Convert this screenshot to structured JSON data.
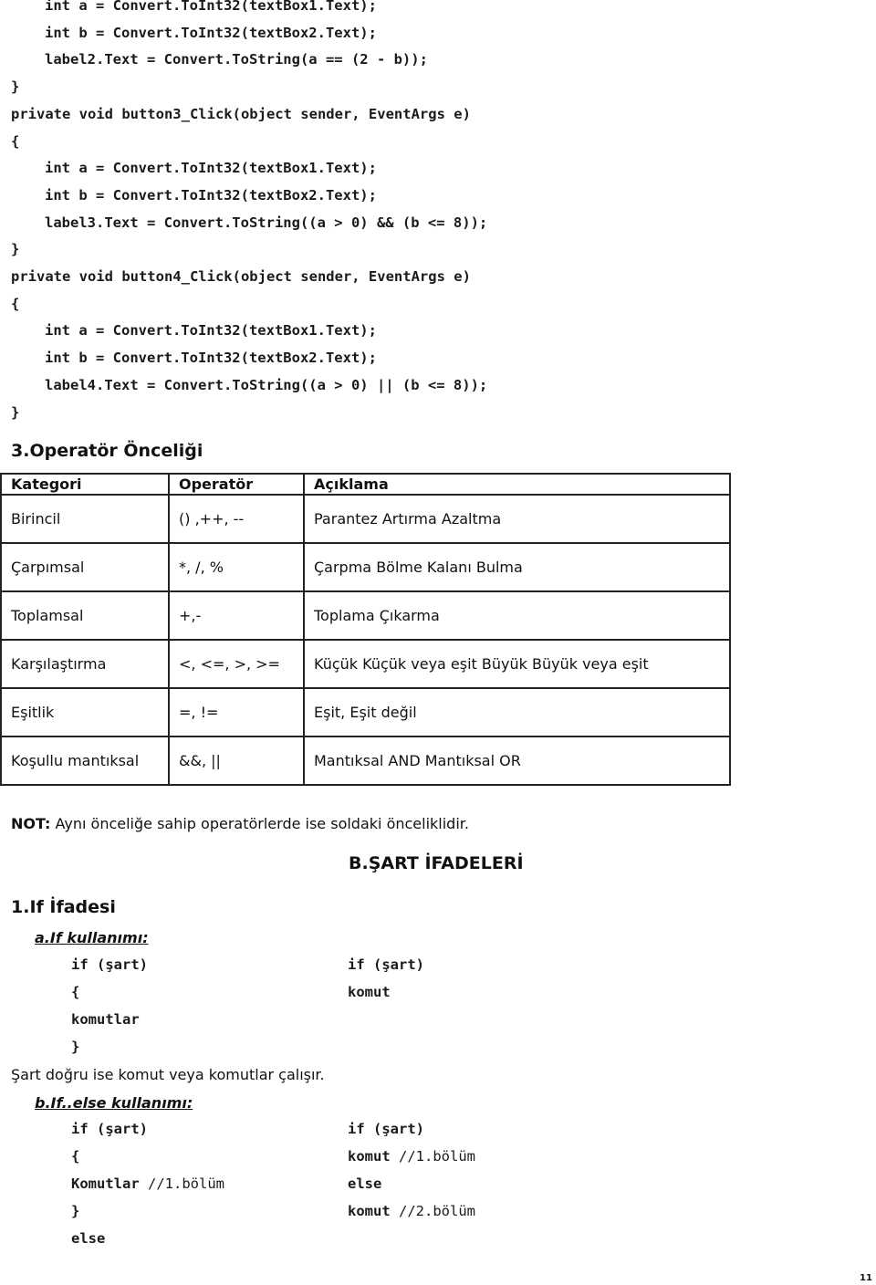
{
  "code_top": [
    {
      "indent": 1,
      "text": "int a = Convert.ToInt32(textBox1.Text);"
    },
    {
      "indent": 1,
      "text": "int b = Convert.ToInt32(textBox2.Text);"
    },
    {
      "indent": 1,
      "text": "label2.Text = Convert.ToString(a == (2 - b));"
    },
    {
      "indent": 0,
      "text": "}"
    },
    {
      "indent": 0,
      "text": "private void button3_Click(object sender, EventArgs e)"
    },
    {
      "indent": 0,
      "text": "{"
    },
    {
      "indent": 1,
      "text": "int a = Convert.ToInt32(textBox1.Text);"
    },
    {
      "indent": 1,
      "text": "int b = Convert.ToInt32(textBox2.Text);"
    },
    {
      "indent": 1,
      "text": "label3.Text = Convert.ToString((a > 0) && (b <= 8));"
    },
    {
      "indent": 0,
      "text": "}"
    },
    {
      "indent": 0,
      "text": "private void button4_Click(object sender, EventArgs e)"
    },
    {
      "indent": 0,
      "text": "{"
    },
    {
      "indent": 1,
      "text": "int a = Convert.ToInt32(textBox1.Text);"
    },
    {
      "indent": 1,
      "text": "int b = Convert.ToInt32(textBox2.Text);"
    },
    {
      "indent": 1,
      "text": "label4.Text = Convert.ToString((a > 0) || (b <= 8));"
    },
    {
      "indent": 0,
      "text": "}"
    }
  ],
  "section_precedence": {
    "title": "3.Operatör Önceliği",
    "headers": [
      "Kategori",
      "Operatör",
      "Açıklama"
    ],
    "rows": [
      [
        "Birincil",
        "() ,++, --",
        "Parantez Artırma Azaltma"
      ],
      [
        "Çarpımsal",
        "*, /, %",
        "Çarpma Bölme Kalanı Bulma"
      ],
      [
        "Toplamsal",
        "+,-",
        "Toplama Çıkarma"
      ],
      [
        "Karşılaştırma",
        "<, <=, >, >=",
        "Küçük Küçük veya eşit Büyük Büyük veya eşit"
      ],
      [
        "Eşitlik",
        "=, !=",
        "Eşit, Eşit değil"
      ],
      [
        "Koşullu mantıksal",
        "&&, ||",
        "Mantıksal AND Mantıksal OR"
      ]
    ],
    "note_label": "NOT:",
    "note_text": " Aynı önceliğe sahip operatörlerde ise soldaki önceliklidir."
  },
  "chapter_title": "B.ŞART İFADELERİ",
  "if_section": {
    "title": "1.If İfadesi",
    "a_title": "a.If kullanımı:",
    "a_left": [
      "if (şart)",
      "{",
      "komutlar",
      "}"
    ],
    "a_right": [
      "if (şart)",
      "komut"
    ],
    "a_desc": "Şart doğru ise komut veya komutlar çalışır.",
    "b_title": "b.If..else kullanımı:",
    "b_left": [
      {
        "code": "if (şart)",
        "comment": ""
      },
      {
        "code": "{",
        "comment": ""
      },
      {
        "code": "Komutlar ",
        "comment": "//1.bölüm"
      },
      {
        "code": "}",
        "comment": ""
      },
      {
        "code": "else",
        "comment": ""
      }
    ],
    "b_right": [
      {
        "code": "if (şart)",
        "comment": ""
      },
      {
        "code": "komut ",
        "comment": "//1.bölüm"
      },
      {
        "code": "else",
        "comment": ""
      },
      {
        "code": "komut ",
        "comment": "//2.bölüm"
      }
    ]
  },
  "page_number": "11"
}
